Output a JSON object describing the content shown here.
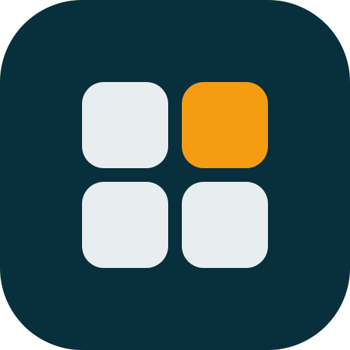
{
  "app_icon": {
    "name": "four-tiles-grid-icon",
    "colors": {
      "background": "#082f3c",
      "tile": "#e8edf0",
      "accent_tile": "#f59c12"
    },
    "tiles": [
      {
        "name": "top-left-tile",
        "color": "#e8edf0"
      },
      {
        "name": "top-right-tile",
        "color": "#f59c12"
      },
      {
        "name": "bottom-left-tile",
        "color": "#e8edf0"
      },
      {
        "name": "bottom-right-tile",
        "color": "#e8edf0"
      }
    ]
  }
}
